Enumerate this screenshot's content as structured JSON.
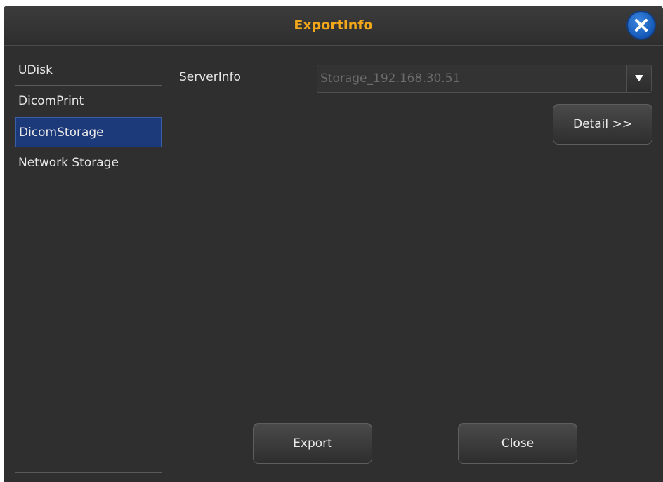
{
  "dialog": {
    "title": "ExportInfo",
    "title_color": "#f2a818",
    "close_icon": "close-x-icon"
  },
  "sidebar": {
    "items": [
      {
        "label": "UDisk",
        "selected": false
      },
      {
        "label": "DicomPrint",
        "selected": false
      },
      {
        "label": "DicomStorage",
        "selected": true
      },
      {
        "label": "Network Storage",
        "selected": false
      }
    ],
    "selected_color": "#1c3a7a"
  },
  "main": {
    "server_label": "ServerInfo",
    "server_value": "Storage_192.168.30.51",
    "dropdown_icon": "dropdown-arrow-icon",
    "detail_label": "Detail >>"
  },
  "footer": {
    "export_label": "Export",
    "close_label": "Close"
  }
}
